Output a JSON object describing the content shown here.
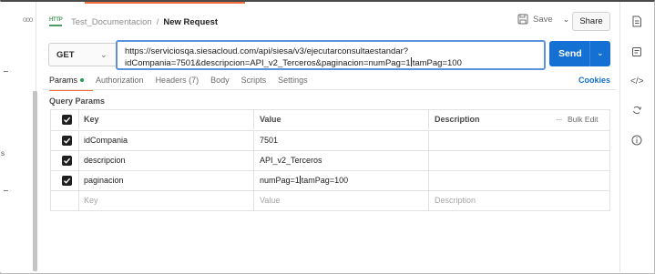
{
  "left_strip": {
    "dots": "ooo",
    "letter": "s"
  },
  "header": {
    "collection": "Test_Documentacion",
    "separator": "/",
    "request_name": "New Request",
    "http_icon_text": "HTTP",
    "save_label": "Save",
    "share_label": "Share"
  },
  "request": {
    "method": "GET",
    "url_line1": "https://serviciosqa.siesacloud.com/api/siesa/v3/ejecutarconsultaestandar?",
    "url_line2_a": "idCompania=7501&descripcion=API_v2_Terceros&paginacion=numPag=1",
    "url_line2_b": "tamPag=100",
    "send_label": "Send"
  },
  "tabs": [
    {
      "label": "Params"
    },
    {
      "label": "Authorization"
    },
    {
      "label": "Headers (7)"
    },
    {
      "label": "Body"
    },
    {
      "label": "Scripts"
    },
    {
      "label": "Settings"
    }
  ],
  "cookies_label": "Cookies",
  "query_params": {
    "title": "Query Params",
    "headers": {
      "key": "Key",
      "value": "Value",
      "description": "Description",
      "bulk_edit": "Bulk Edit",
      "more": "···"
    },
    "rows": [
      {
        "key": "idCompania",
        "value": "7501",
        "description": ""
      },
      {
        "key": "descripcion",
        "value": "API_v2_Terceros",
        "description": ""
      },
      {
        "key": "paginacion",
        "value_a": "numPag=1",
        "value_b": "tamPag=100",
        "description": ""
      }
    ],
    "placeholders": {
      "key": "Key",
      "value": "Value",
      "description": "Description"
    }
  },
  "right_sidebar": {
    "icons": [
      "document-icon",
      "comment-icon",
      "code-icon",
      "refresh-icon",
      "info-icon"
    ]
  },
  "colors": {
    "accent": "#f26b3a",
    "send": "#1470d2",
    "url_focus": "#5a93dc",
    "status_dot": "#2e9b55"
  }
}
